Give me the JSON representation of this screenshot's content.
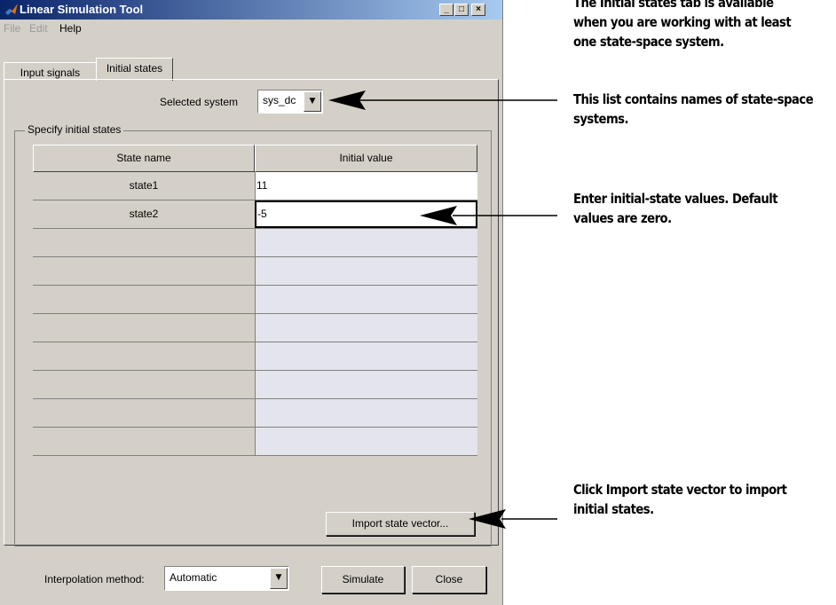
{
  "window": {
    "title": "Linear Simulation Tool",
    "controls": [
      "_",
      "□",
      "×"
    ]
  },
  "menu": [
    "File",
    "Edit",
    "Help"
  ],
  "tabs": [
    {
      "label": "Input signals",
      "active": false
    },
    {
      "label": "Initial states",
      "active": true
    }
  ],
  "selected_system": {
    "label": "Selected system",
    "value": "sys_dc"
  },
  "group_title": "Specify initial states",
  "table": {
    "headers": [
      "State name",
      "Initial value"
    ],
    "rows": [
      {
        "name": "state1",
        "value": "11"
      },
      {
        "name": "state2",
        "value": "-5"
      }
    ]
  },
  "import_button": "Import state vector...",
  "interpolation": {
    "label": "Interpolation method:",
    "value": "Automatic"
  },
  "simulate_button": "Simulate",
  "close_button": "Close",
  "annotations": {
    "tab_note_1": "The Initial states tab is available",
    "tab_note_2": "when you are working with at least",
    "tab_note_3": "one state-space system.",
    "list_note_1": "This list contains names of state-space",
    "list_note_2": "systems.",
    "values_note_1": "Enter initial-state values. Default",
    "values_note_2": "values are zero.",
    "import_note_1": "Click Import state vector to import",
    "import_note_2": "initial states."
  }
}
